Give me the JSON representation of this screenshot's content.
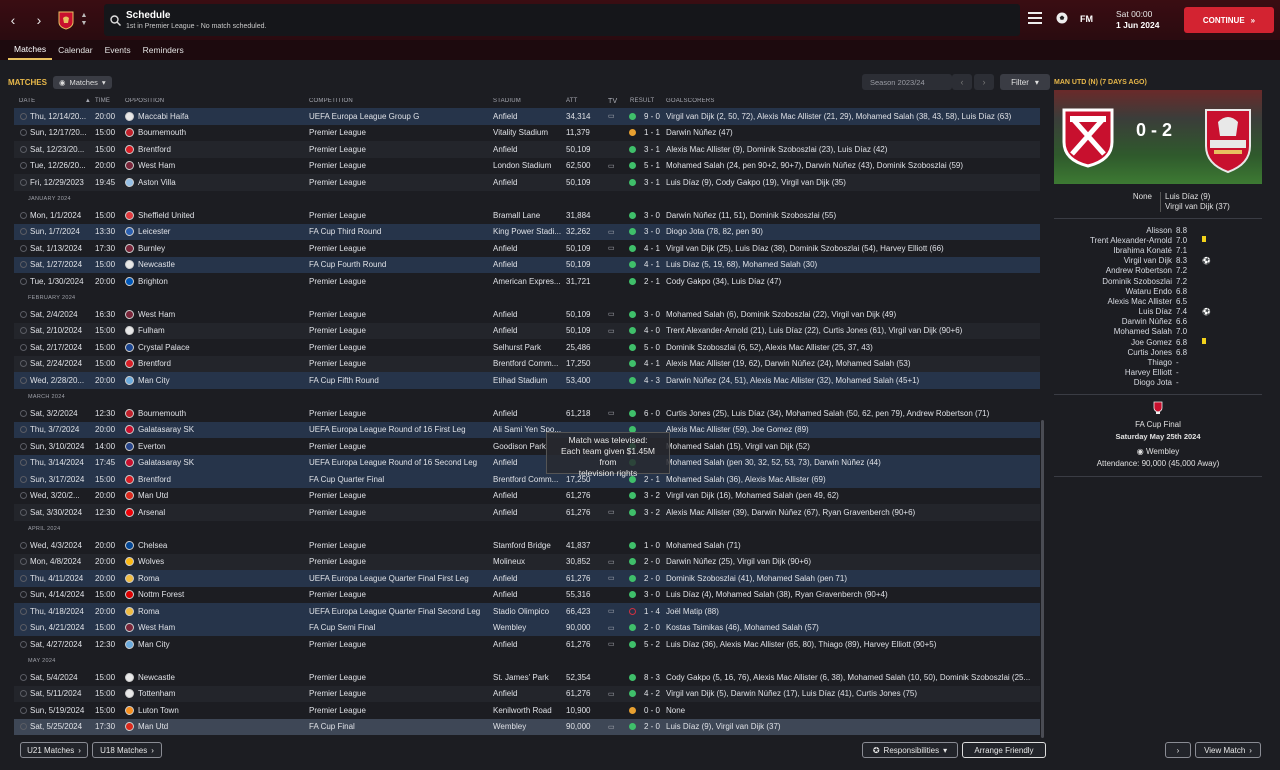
{
  "topbar": {
    "back": "‹",
    "forward": "›",
    "title": "Schedule",
    "subtitle": "1st in Premier League - No match scheduled.",
    "fm": "FM",
    "date_line1": "Sat 00:00",
    "date_line2": "1 Jun 2024",
    "continue": "CONTINUE"
  },
  "subnav": {
    "tabs": [
      "Matches",
      "Calendar",
      "Events",
      "Reminders"
    ]
  },
  "toolbar": {
    "heading": "MATCHES",
    "view_select": "Matches",
    "season": "Season 2023/24",
    "filter": "Filter"
  },
  "table": {
    "headers": [
      "DATE",
      "TIME",
      "OPPOSITION",
      "COMPETITION",
      "STADIUM",
      "ATT",
      "TV",
      "RESULT",
      "GOALSCORERS"
    ],
    "rows": [
      {
        "type": "row",
        "style": "cup",
        "date": "Thu, 12/14/20...",
        "time": "20:00",
        "opp": "Maccabi Haifa",
        "bc": "#e8e8e8",
        "comp": "UEFA Europa League Group G",
        "stad": "Anfield",
        "att": "34,314",
        "tv": "▭",
        "ind": "#3fbf6a",
        "res": "9 - 0",
        "sc": "Virgil van Dijk (2, 50, 72), Alexis Mac Allister (21, 29), Mohamed Salah (38, 43, 58), Luis Díaz (63)"
      },
      {
        "type": "row",
        "style": "",
        "date": "Sun, 12/17/20...",
        "time": "15:00",
        "opp": "Bournemouth",
        "bc": "#c0202a",
        "comp": "Premier League",
        "stad": "Vitality Stadium",
        "att": "11,379",
        "tv": "",
        "ind": "#e8a030",
        "res": "1 - 1",
        "sc": "Darwin Núñez (47)"
      },
      {
        "type": "row",
        "style": "odd",
        "date": "Sat, 12/23/20...",
        "time": "15:00",
        "opp": "Brentford",
        "bc": "#d81e26",
        "comp": "Premier League",
        "stad": "Anfield",
        "att": "50,109",
        "tv": "",
        "ind": "#3fbf6a",
        "res": "3 - 1",
        "sc": "Alexis Mac Allister (9), Dominik Szoboszlai (23), Luis Díaz (42)"
      },
      {
        "type": "row",
        "style": "",
        "date": "Tue, 12/26/20...",
        "time": "20:00",
        "opp": "West Ham",
        "bc": "#7a263a",
        "comp": "Premier League",
        "stad": "London Stadium",
        "att": "62,500",
        "tv": "▭",
        "ind": "#3fbf6a",
        "res": "5 - 1",
        "sc": "Mohamed Salah (24, pen 90+2, 90+7), Darwin Núñez (43), Dominik Szoboszlai (59)"
      },
      {
        "type": "row",
        "style": "odd",
        "date": "Fri, 12/29/2023",
        "time": "19:45",
        "opp": "Aston Villa",
        "bc": "#95bfe5",
        "comp": "Premier League",
        "stad": "Anfield",
        "att": "50,109",
        "tv": "",
        "ind": "#3fbf6a",
        "res": "3 - 1",
        "sc": "Luis Díaz (9), Cody Gakpo (19), Virgil van Dijk (35)"
      },
      {
        "type": "head",
        "label": "JANUARY 2024"
      },
      {
        "type": "row",
        "style": "",
        "date": "Mon, 1/1/2024",
        "time": "15:00",
        "opp": "Sheffield United",
        "bc": "#e03a3e",
        "comp": "Premier League",
        "stad": "Bramall Lane",
        "att": "31,884",
        "tv": "",
        "ind": "#3fbf6a",
        "res": "3 - 0",
        "sc": "Darwin Núñez (11, 51), Dominik Szoboszlai (55)"
      },
      {
        "type": "row",
        "style": "cup",
        "date": "Sun, 1/7/2024",
        "time": "13:30",
        "opp": "Leicester",
        "bc": "#2a5fb0",
        "comp": "FA Cup Third Round",
        "stad": "King Power Stadi...",
        "att": "32,262",
        "tv": "▭",
        "ind": "#3fbf6a",
        "res": "3 - 0",
        "sc": "Diogo Jota (78, 82, pen 90)"
      },
      {
        "type": "row",
        "style": "",
        "date": "Sat, 1/13/2024",
        "time": "17:30",
        "opp": "Burnley",
        "bc": "#7a263a",
        "comp": "Premier League",
        "stad": "Anfield",
        "att": "50,109",
        "tv": "▭",
        "ind": "#3fbf6a",
        "res": "4 - 1",
        "sc": "Virgil van Dijk (25), Luis Díaz (38), Dominik Szoboszlai (54), Harvey Elliott (66)"
      },
      {
        "type": "row",
        "style": "cup",
        "date": "Sat, 1/27/2024",
        "time": "15:00",
        "opp": "Newcastle",
        "bc": "#e8e8e8",
        "comp": "FA Cup Fourth Round",
        "stad": "Anfield",
        "att": "50,109",
        "tv": "",
        "ind": "#3fbf6a",
        "res": "4 - 1",
        "sc": "Luis Díaz (5, 19, 68), Mohamed Salah (30)"
      },
      {
        "type": "row",
        "style": "",
        "date": "Tue, 1/30/2024",
        "time": "20:00",
        "opp": "Brighton",
        "bc": "#0057b8",
        "comp": "Premier League",
        "stad": "American Expres...",
        "att": "31,721",
        "tv": "",
        "ind": "#3fbf6a",
        "res": "2 - 1",
        "sc": "Cody Gakpo (34), Luis Díaz (47)"
      },
      {
        "type": "head",
        "label": "FEBRUARY 2024"
      },
      {
        "type": "row",
        "style": "",
        "date": "Sat, 2/4/2024",
        "time": "16:30",
        "opp": "West Ham",
        "bc": "#7a263a",
        "comp": "Premier League",
        "stad": "Anfield",
        "att": "50,109",
        "tv": "▭",
        "ind": "#3fbf6a",
        "res": "3 - 0",
        "sc": "Mohamed Salah (6), Dominik Szoboszlai (22), Virgil van Dijk (49)"
      },
      {
        "type": "row",
        "style": "odd",
        "date": "Sat, 2/10/2024",
        "time": "15:00",
        "opp": "Fulham",
        "bc": "#e8e8e8",
        "comp": "Premier League",
        "stad": "Anfield",
        "att": "50,109",
        "tv": "▭",
        "ind": "#3fbf6a",
        "res": "4 - 0",
        "sc": "Trent Alexander-Arnold (21), Luis Díaz (22), Curtis Jones (61), Virgil van Dijk (90+6)"
      },
      {
        "type": "row",
        "style": "",
        "date": "Sat, 2/17/2024",
        "time": "15:00",
        "opp": "Crystal Palace",
        "bc": "#1b458f",
        "comp": "Premier League",
        "stad": "Selhurst Park",
        "att": "25,486",
        "tv": "",
        "ind": "#3fbf6a",
        "res": "5 - 0",
        "sc": "Dominik Szoboszlai (6, 52), Alexis Mac Allister (25, 37, 43)"
      },
      {
        "type": "row",
        "style": "odd",
        "date": "Sat, 2/24/2024",
        "time": "15:00",
        "opp": "Brentford",
        "bc": "#d81e26",
        "comp": "Premier League",
        "stad": "Brentford Comm...",
        "att": "17,250",
        "tv": "",
        "ind": "#3fbf6a",
        "res": "4 - 1",
        "sc": "Alexis Mac Allister (19, 62), Darwin Núñez (24), Mohamed Salah (53)"
      },
      {
        "type": "row",
        "style": "cup",
        "date": "Wed, 2/28/20...",
        "time": "20:00",
        "opp": "Man City",
        "bc": "#6cabdd",
        "comp": "FA Cup Fifth Round",
        "stad": "Etihad Stadium",
        "att": "53,400",
        "tv": "",
        "ind": "#3fbf6a",
        "res": "4 - 3",
        "sc": "Darwin Núñez (24, 51), Alexis Mac Allister (32), Mohamed Salah (45+1)"
      },
      {
        "type": "head",
        "label": "MARCH 2024"
      },
      {
        "type": "row",
        "style": "",
        "date": "Sat, 3/2/2024",
        "time": "12:30",
        "opp": "Bournemouth",
        "bc": "#c0202a",
        "comp": "Premier League",
        "stad": "Anfield",
        "att": "61,218",
        "tv": "▭",
        "ind": "#3fbf6a",
        "res": "6 - 0",
        "sc": "Curtis Jones (25), Luis Díaz (34), Mohamed Salah (50, 62, pen 79), Andrew Robertson (71)"
      },
      {
        "type": "row",
        "style": "cup",
        "date": "Thu, 3/7/2024",
        "time": "20:00",
        "opp": "Galatasaray SK",
        "bc": "#c8102e",
        "comp": "UEFA Europa League Round of 16 First Leg",
        "stad": "Ali Sami Yen Spo...",
        "att": "",
        "tv": "",
        "ind": "#3fbf6a",
        "res": "",
        "sc": "Alexis Mac Allister (59), Joe Gomez (89)"
      },
      {
        "type": "row",
        "style": "",
        "date": "Sun, 3/10/2024",
        "time": "14:00",
        "opp": "Everton",
        "bc": "#274488",
        "comp": "Premier League",
        "stad": "Goodison Park",
        "att": "",
        "tv": "",
        "ind": "#3fbf6a",
        "res": "",
        "sc": "Mohamed Salah (15), Virgil van Dijk (52)"
      },
      {
        "type": "row",
        "style": "cup",
        "date": "Thu, 3/14/2024",
        "time": "17:45",
        "opp": "Galatasaray SK",
        "bc": "#c8102e",
        "comp": "UEFA Europa League Round of 16 Second Leg",
        "stad": "Anfield",
        "att": "",
        "tv": "",
        "ind": "#3fbf6a",
        "res": "",
        "sc": "Mohamed Salah (pen 30, 32, 52, 53, 73), Darwin Núñez (44)"
      },
      {
        "type": "row",
        "style": "cup",
        "date": "Sun, 3/17/2024",
        "time": "15:00",
        "opp": "Brentford",
        "bc": "#d81e26",
        "comp": "FA Cup Quarter Final",
        "stad": "Brentford Comm...",
        "att": "17,250",
        "tv": "",
        "ind": "#3fbf6a",
        "res": "2 - 1",
        "sc": "Mohamed Salah (36), Alexis Mac Allister (69)"
      },
      {
        "type": "row",
        "style": "",
        "date": "Wed, 3/20/2...",
        "time": "20:00",
        "opp": "Man Utd",
        "bc": "#da291c",
        "comp": "Premier League",
        "stad": "Anfield",
        "att": "61,276",
        "tv": "",
        "ind": "#3fbf6a",
        "res": "3 - 2",
        "sc": "Virgil van Dijk (16), Mohamed Salah (pen 49, 62)"
      },
      {
        "type": "row",
        "style": "odd",
        "date": "Sat, 3/30/2024",
        "time": "12:30",
        "opp": "Arsenal",
        "bc": "#ef0107",
        "comp": "Premier League",
        "stad": "Anfield",
        "att": "61,276",
        "tv": "▭",
        "ind": "#3fbf6a",
        "res": "3 - 2",
        "sc": "Alexis Mac Allister (39), Darwin Núñez (67), Ryan Gravenberch (90+6)"
      },
      {
        "type": "head",
        "label": "APRIL 2024"
      },
      {
        "type": "row",
        "style": "",
        "date": "Wed, 4/3/2024",
        "time": "20:00",
        "opp": "Chelsea",
        "bc": "#034694",
        "comp": "Premier League",
        "stad": "Stamford Bridge",
        "att": "41,837",
        "tv": "",
        "ind": "#3fbf6a",
        "res": "1 - 0",
        "sc": "Mohamed Salah (71)"
      },
      {
        "type": "row",
        "style": "odd",
        "date": "Mon, 4/8/2024",
        "time": "20:00",
        "opp": "Wolves",
        "bc": "#fdb913",
        "comp": "Premier League",
        "stad": "Molineux",
        "att": "30,852",
        "tv": "▭",
        "ind": "#3fbf6a",
        "res": "2 - 0",
        "sc": "Darwin Núñez (25), Virgil van Dijk (90+6)"
      },
      {
        "type": "row",
        "style": "cup",
        "date": "Thu, 4/11/2024",
        "time": "20:00",
        "opp": "Roma",
        "bc": "#f0bc42",
        "comp": "UEFA Europa League Quarter Final First Leg",
        "stad": "Anfield",
        "att": "61,276",
        "tv": "▭",
        "ind": "#3fbf6a",
        "res": "2 - 0",
        "sc": "Dominik Szoboszlai (41), Mohamed Salah (pen 71)"
      },
      {
        "type": "row",
        "style": "",
        "date": "Sun, 4/14/2024",
        "time": "15:00",
        "opp": "Nottm Forest",
        "bc": "#dd0000",
        "comp": "Premier League",
        "stad": "Anfield",
        "att": "55,316",
        "tv": "",
        "ind": "#3fbf6a",
        "res": "3 - 0",
        "sc": "Luis Díaz (4), Mohamed Salah (38), Ryan Gravenberch (90+4)"
      },
      {
        "type": "row",
        "style": "cup",
        "date": "Thu, 4/18/2024",
        "time": "20:00",
        "opp": "Roma",
        "bc": "#f0bc42",
        "comp": "UEFA Europa League Quarter Final Second Leg",
        "stad": "Stadio Olimpico",
        "att": "66,423",
        "tv": "▭",
        "ind": "#d03040",
        "res": "1 - 4",
        "sc": "Joël Matip (88)"
      },
      {
        "type": "row",
        "style": "cup",
        "date": "Sun, 4/21/2024",
        "time": "15:00",
        "opp": "West Ham",
        "bc": "#7a263a",
        "comp": "FA Cup Semi Final",
        "stad": "Wembley",
        "att": "90,000",
        "tv": "▭",
        "ind": "#3fbf6a",
        "res": "2 - 0",
        "sc": "Kostas Tsimikas (46), Mohamed Salah (57)"
      },
      {
        "type": "row",
        "style": "",
        "date": "Sat, 4/27/2024",
        "time": "12:30",
        "opp": "Man City",
        "bc": "#6cabdd",
        "comp": "Premier League",
        "stad": "Anfield",
        "att": "61,276",
        "tv": "▭",
        "ind": "#3fbf6a",
        "res": "5 - 2",
        "sc": "Luis Díaz (36), Alexis Mac Allister (65, 80), Thiago (89), Harvey Elliott (90+5)"
      },
      {
        "type": "head",
        "label": "MAY 2024"
      },
      {
        "type": "row",
        "style": "",
        "date": "Sat, 5/4/2024",
        "time": "15:00",
        "opp": "Newcastle",
        "bc": "#e8e8e8",
        "comp": "Premier League",
        "stad": "St. James' Park",
        "att": "52,354",
        "tv": "",
        "ind": "#3fbf6a",
        "res": "8 - 3",
        "sc": "Cody Gakpo (5, 16, 76), Alexis Mac Allister (6, 38), Mohamed Salah (10, 50), Dominik Szoboszlai (25..."
      },
      {
        "type": "row",
        "style": "odd",
        "date": "Sat, 5/11/2024",
        "time": "15:00",
        "opp": "Tottenham",
        "bc": "#e8e8e8",
        "comp": "Premier League",
        "stad": "Anfield",
        "att": "61,276",
        "tv": "▭",
        "ind": "#3fbf6a",
        "res": "4 - 2",
        "sc": "Virgil van Dijk (5), Darwin Núñez (17), Luis Díaz (41), Curtis Jones (75)"
      },
      {
        "type": "row",
        "style": "",
        "date": "Sun, 5/19/2024",
        "time": "15:00",
        "opp": "Luton Town",
        "bc": "#f78f1e",
        "comp": "Premier League",
        "stad": "Kenilworth Road",
        "att": "10,900",
        "tv": "",
        "ind": "#e8a030",
        "res": "0 - 0",
        "sc": "None"
      },
      {
        "type": "row",
        "style": "sel",
        "date": "Sat, 5/25/2024",
        "time": "17:30",
        "opp": "Man Utd",
        "bc": "#da291c",
        "comp": "FA Cup Final",
        "stad": "Wembley",
        "att": "90,000",
        "tv": "▭",
        "ind": "#3fbf6a",
        "res": "2 - 0",
        "sc": "Luis Díaz (9), Virgil van Dijk (37)"
      }
    ]
  },
  "tooltip": {
    "line1": "Match was televised:",
    "line2": "Each team given $1.45M from",
    "line3": "television rights"
  },
  "right": {
    "title": "MAN UTD (N) (7 DAYS AGO)",
    "score": "0 - 2",
    "home_scorers": "None",
    "away_scorer1": "Luis Díaz (9)",
    "away_scorer2": "Virgil van Dijk (37)",
    "lineup": [
      {
        "n": "Alisson",
        "r": "8.8",
        "e": ""
      },
      {
        "n": "Trent Alexander-Arnold",
        "r": "7.0",
        "e": "yellow"
      },
      {
        "n": "Ibrahima Konaté",
        "r": "7.1",
        "e": ""
      },
      {
        "n": "Virgil van Dijk",
        "r": "8.3",
        "e": "ball"
      },
      {
        "n": "Andrew Robertson",
        "r": "7.2",
        "e": ""
      },
      {
        "n": "Dominik Szoboszlai",
        "r": "7.2",
        "e": ""
      },
      {
        "n": "Wataru Endo",
        "r": "6.8",
        "e": ""
      },
      {
        "n": "Alexis Mac Allister",
        "r": "6.5",
        "e": ""
      },
      {
        "n": "Luis Díaz",
        "r": "7.4",
        "e": "ball"
      },
      {
        "n": "Darwin Núñez",
        "r": "6.6",
        "e": ""
      },
      {
        "n": "Mohamed Salah",
        "r": "7.0",
        "e": ""
      },
      {
        "n": "Joe Gomez",
        "r": "6.8",
        "e": "yellow"
      },
      {
        "n": "Curtis Jones",
        "r": "6.8",
        "e": ""
      },
      {
        "n": "Thiago",
        "r": "-",
        "e": ""
      },
      {
        "n": "Harvey Elliott",
        "r": "-",
        "e": ""
      },
      {
        "n": "Diogo Jota",
        "r": "-",
        "e": ""
      }
    ],
    "competition": "FA Cup Final",
    "match_date": "Saturday May 25th 2024",
    "stadium": "Wembley",
    "attendance": "Attendance: 90,000 (45,000 Away)"
  },
  "bottom": {
    "u21": "U21 Matches",
    "u18": "U18 Matches",
    "responsibilities": "Responsibilities",
    "arrange": "Arrange Friendly",
    "view_match": "View Match"
  },
  "colors": {
    "accent": "#e8b84a",
    "continue": "#d32331",
    "win": "#3fbf6a",
    "draw": "#e8a030",
    "loss": "#d03040"
  }
}
